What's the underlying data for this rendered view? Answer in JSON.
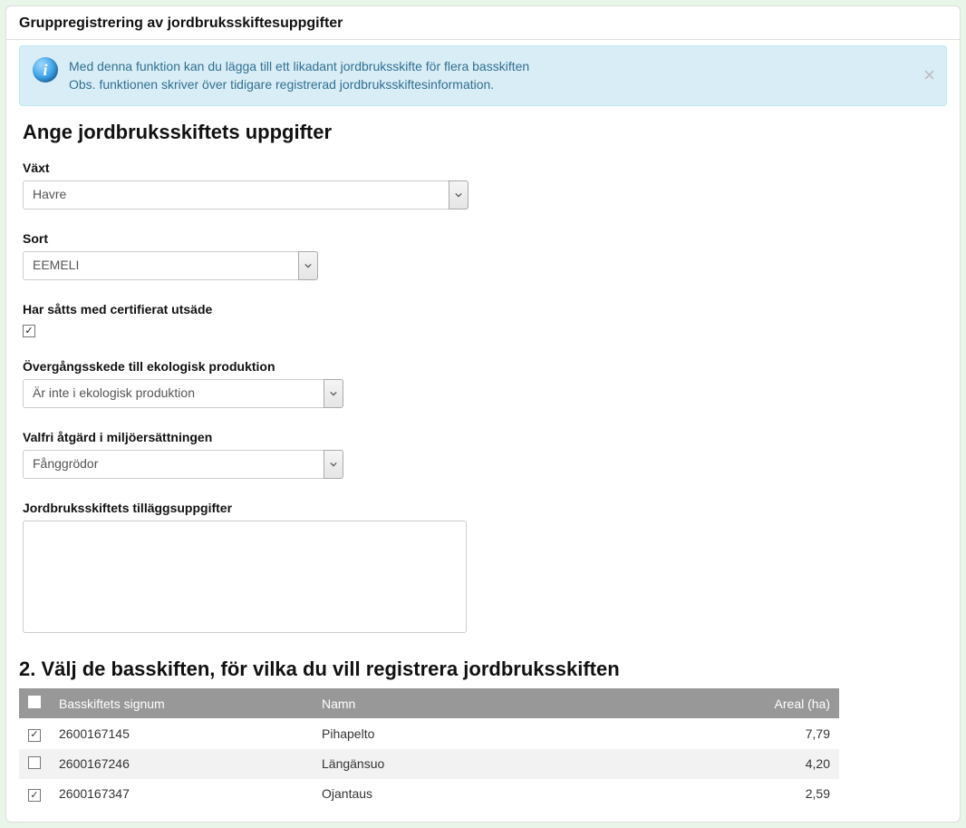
{
  "card_title": "Gruppregistrering av jordbruksskiftesuppgifter",
  "info": {
    "line1": "Med denna funktion kan du lägga till ett likadant jordbruksskifte för flera basskiften",
    "line2": "Obs. funktionen skriver över tidigare registrerad jordbruksskiftesinformation.",
    "close": "×",
    "icon_letter": "i"
  },
  "section1_title": "Ange jordbruksskiftets uppgifter",
  "fields": {
    "plant": {
      "label": "Växt",
      "value": "Havre"
    },
    "variety": {
      "label": "Sort",
      "value": "EEMELI"
    },
    "certified": {
      "label": "Har såtts med certifierat utsäde",
      "checked": true
    },
    "transition": {
      "label": "Övergångsskede till ekologisk produktion",
      "value": "Är inte i ekologisk produktion"
    },
    "env_action": {
      "label": "Valfri åtgärd i miljöersättningen",
      "value": "Fånggrödor"
    },
    "extra": {
      "label": "Jordbruksskiftets tilläggsuppgifter",
      "value": ""
    }
  },
  "section2_title": "2. Välj de basskiften, för vilka du vill registrera jordbruksskiften",
  "table": {
    "headers": {
      "signum": "Basskiftets signum",
      "name": "Namn",
      "area": "Areal (ha)"
    },
    "rows": [
      {
        "checked": true,
        "signum": "2600167145",
        "name": "Pihapelto",
        "area": "7,79"
      },
      {
        "checked": false,
        "signum": "2600167246",
        "name": "Längänsuo",
        "area": "4,20"
      },
      {
        "checked": true,
        "signum": "2600167347",
        "name": "Ojantaus",
        "area": "2,59"
      }
    ]
  }
}
